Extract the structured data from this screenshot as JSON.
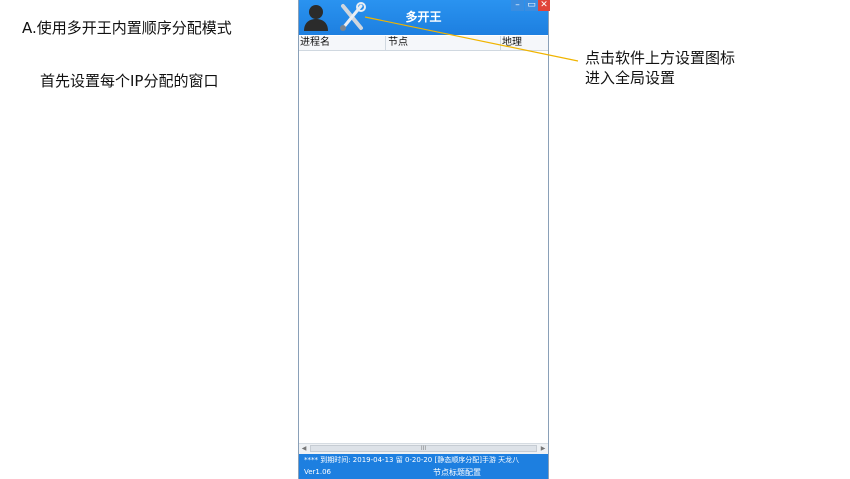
{
  "annotations": {
    "heading": "A.使用多开王内置顺序分配模式",
    "step": "首先设置每个IP分配的窗口",
    "callout_line1": "点击软件上方设置图标",
    "callout_line2": "进入全局设置"
  },
  "app": {
    "title": "多开王",
    "window_buttons": {
      "minimize": "–",
      "restore": "▭",
      "close": "✕"
    },
    "columns": [
      "进程名",
      "节点",
      "地理"
    ],
    "scrollbar_thumb_mark": "III",
    "status": {
      "line1": "****    到期时间: 2019-04-13 留 0-20-20 [静态顺序分配]手游 天龙八",
      "version": "Ver1.06",
      "node_config": "节点标题配置"
    }
  },
  "colors": {
    "titlebar": "#1d7fe0",
    "callout_line": "#f0b400",
    "close_button": "#e0443a"
  }
}
